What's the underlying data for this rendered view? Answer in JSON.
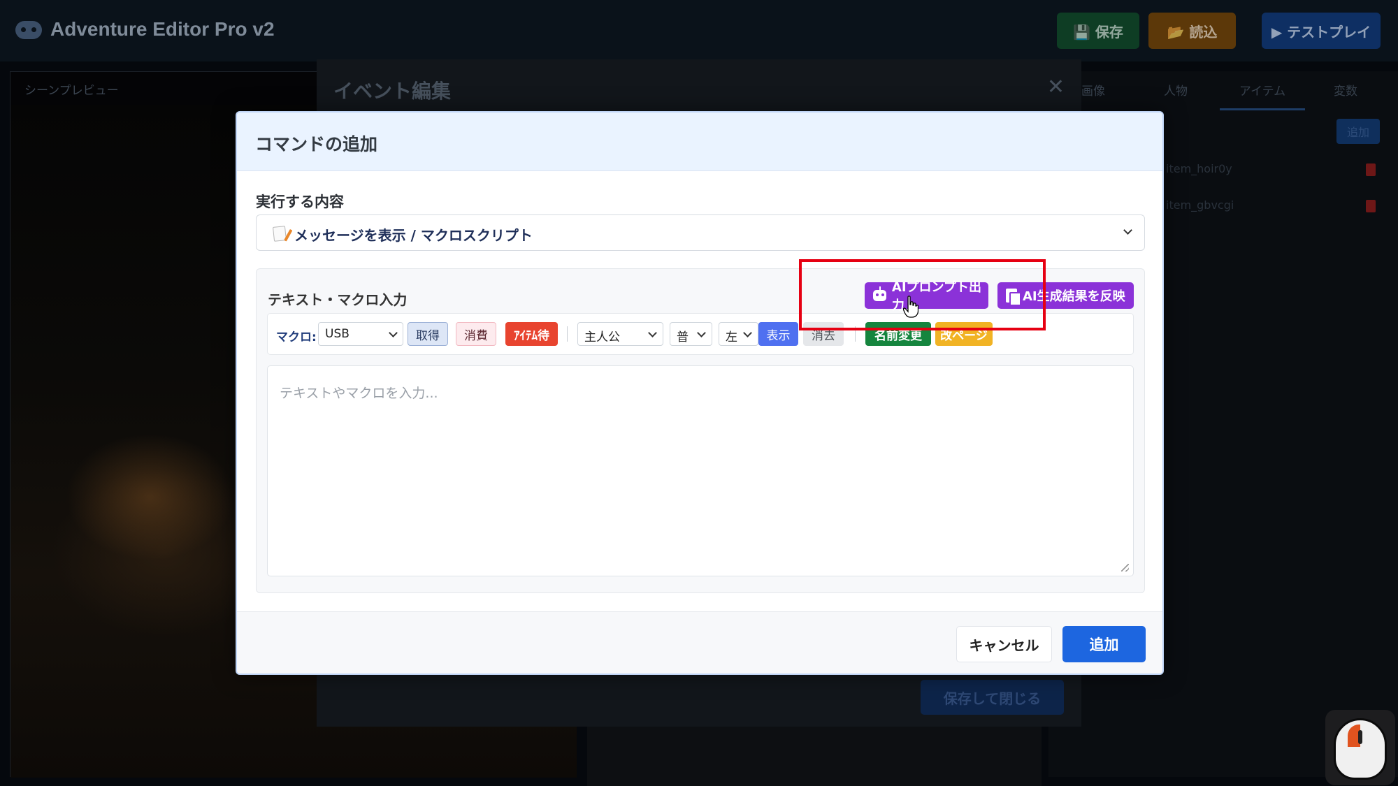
{
  "app": {
    "title": "Adventure Editor Pro v2",
    "buttons": {
      "save": "💾 保存",
      "load": "📂 読込",
      "test": "▶ テストプレイ"
    }
  },
  "scene": {
    "label": "シーンプレビュー"
  },
  "right_panel": {
    "tabs": [
      "画像",
      "人物",
      "アイテム",
      "変数"
    ],
    "active_tab": "アイテム",
    "add_label": "追加",
    "items": [
      "item_hoir0y",
      "item_gbvcgi"
    ]
  },
  "event_modal": {
    "title": "イベント編集",
    "close": "✕",
    "save_close": "保存して閉じる"
  },
  "dialog": {
    "title": "コマンドの追加",
    "action_label": "実行する内容",
    "action_selected": "メッセージを表示 / マクロスクリプト",
    "text_panel": {
      "label": "テキスト・マクロ入力",
      "ai_prompt": "AIプロンプト出力",
      "ai_reflect": "AI生成結果を反映",
      "macro": {
        "label": "マクロ:",
        "item_select": "USB",
        "btn_get": "取得",
        "btn_use": "消費",
        "btn_wait": "ｱｲﾃﾑ待",
        "char_select": "主人公",
        "expr_select": "普",
        "pos_select": "左",
        "btn_show": "表示",
        "btn_hide": "消去",
        "btn_rename": "名前変更",
        "btn_page": "改ページ"
      },
      "placeholder": "テキストやマクロを入力..."
    },
    "cancel": "キャンセル",
    "add": "追加"
  }
}
